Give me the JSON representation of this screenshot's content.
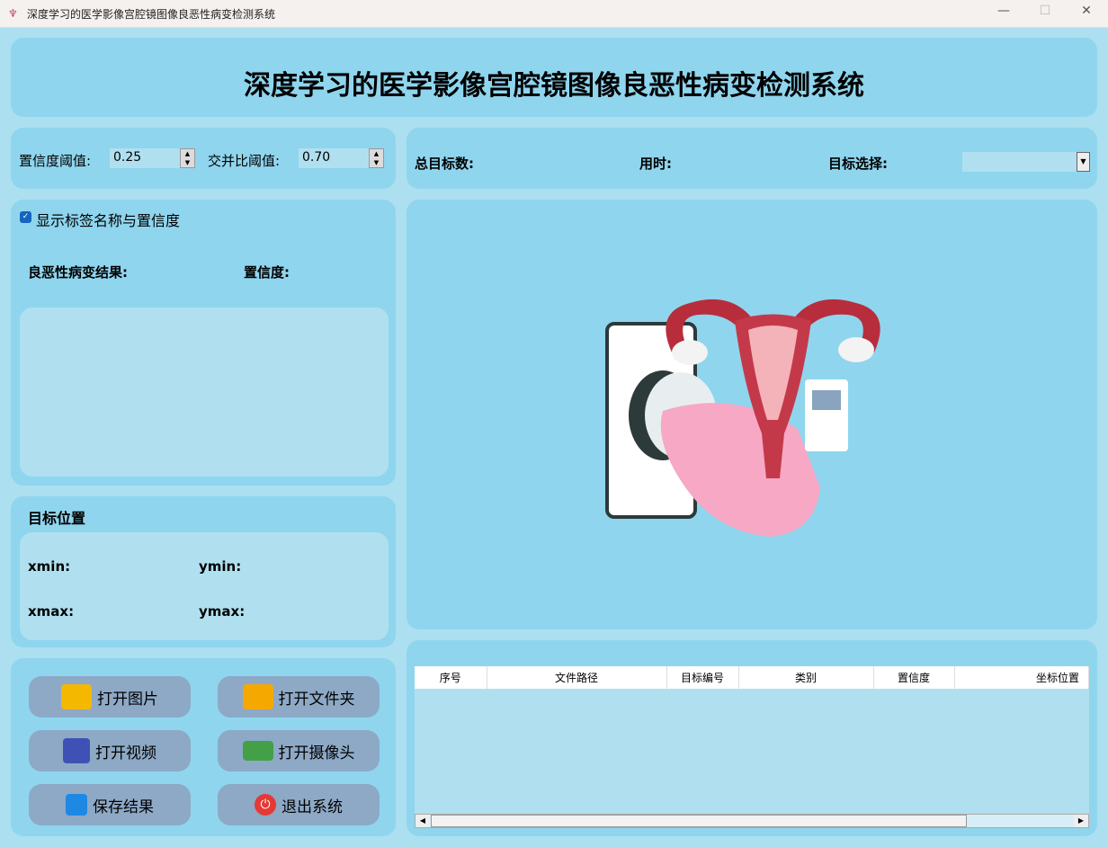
{
  "window": {
    "title": "深度学习的医学影像宫腔镜图像良恶性病变检测系统",
    "min": "—",
    "max": "☐",
    "close": "✕"
  },
  "header": {
    "title": "深度学习的医学影像宫腔镜图像良恶性病变检测系统"
  },
  "params": {
    "conf_label": "置信度阈值:",
    "conf_value": "0.25",
    "iou_label": "交并比阈值:",
    "iou_value": "0.70"
  },
  "stats": {
    "total_label": "总目标数:",
    "time_label": "用时:",
    "select_label": "目标选择:",
    "select_value": ""
  },
  "result": {
    "show_labels": "显示标签名称与置信度",
    "show_labels_checked": true,
    "result_label": "良恶性病变结果:",
    "conf_label": "置信度:"
  },
  "position": {
    "title": "目标位置",
    "xmin": "xmin:",
    "ymin": "ymin:",
    "xmax": "xmax:",
    "ymax": "ymax:"
  },
  "buttons": {
    "open_image": "打开图片",
    "open_folder": "打开文件夹",
    "open_video": "打开视频",
    "open_camera": "打开摄像头",
    "save": "保存结果",
    "exit": "退出系统"
  },
  "table": {
    "columns": [
      "序号",
      "文件路径",
      "目标编号",
      "类别",
      "置信度",
      "坐标位置"
    ]
  }
}
